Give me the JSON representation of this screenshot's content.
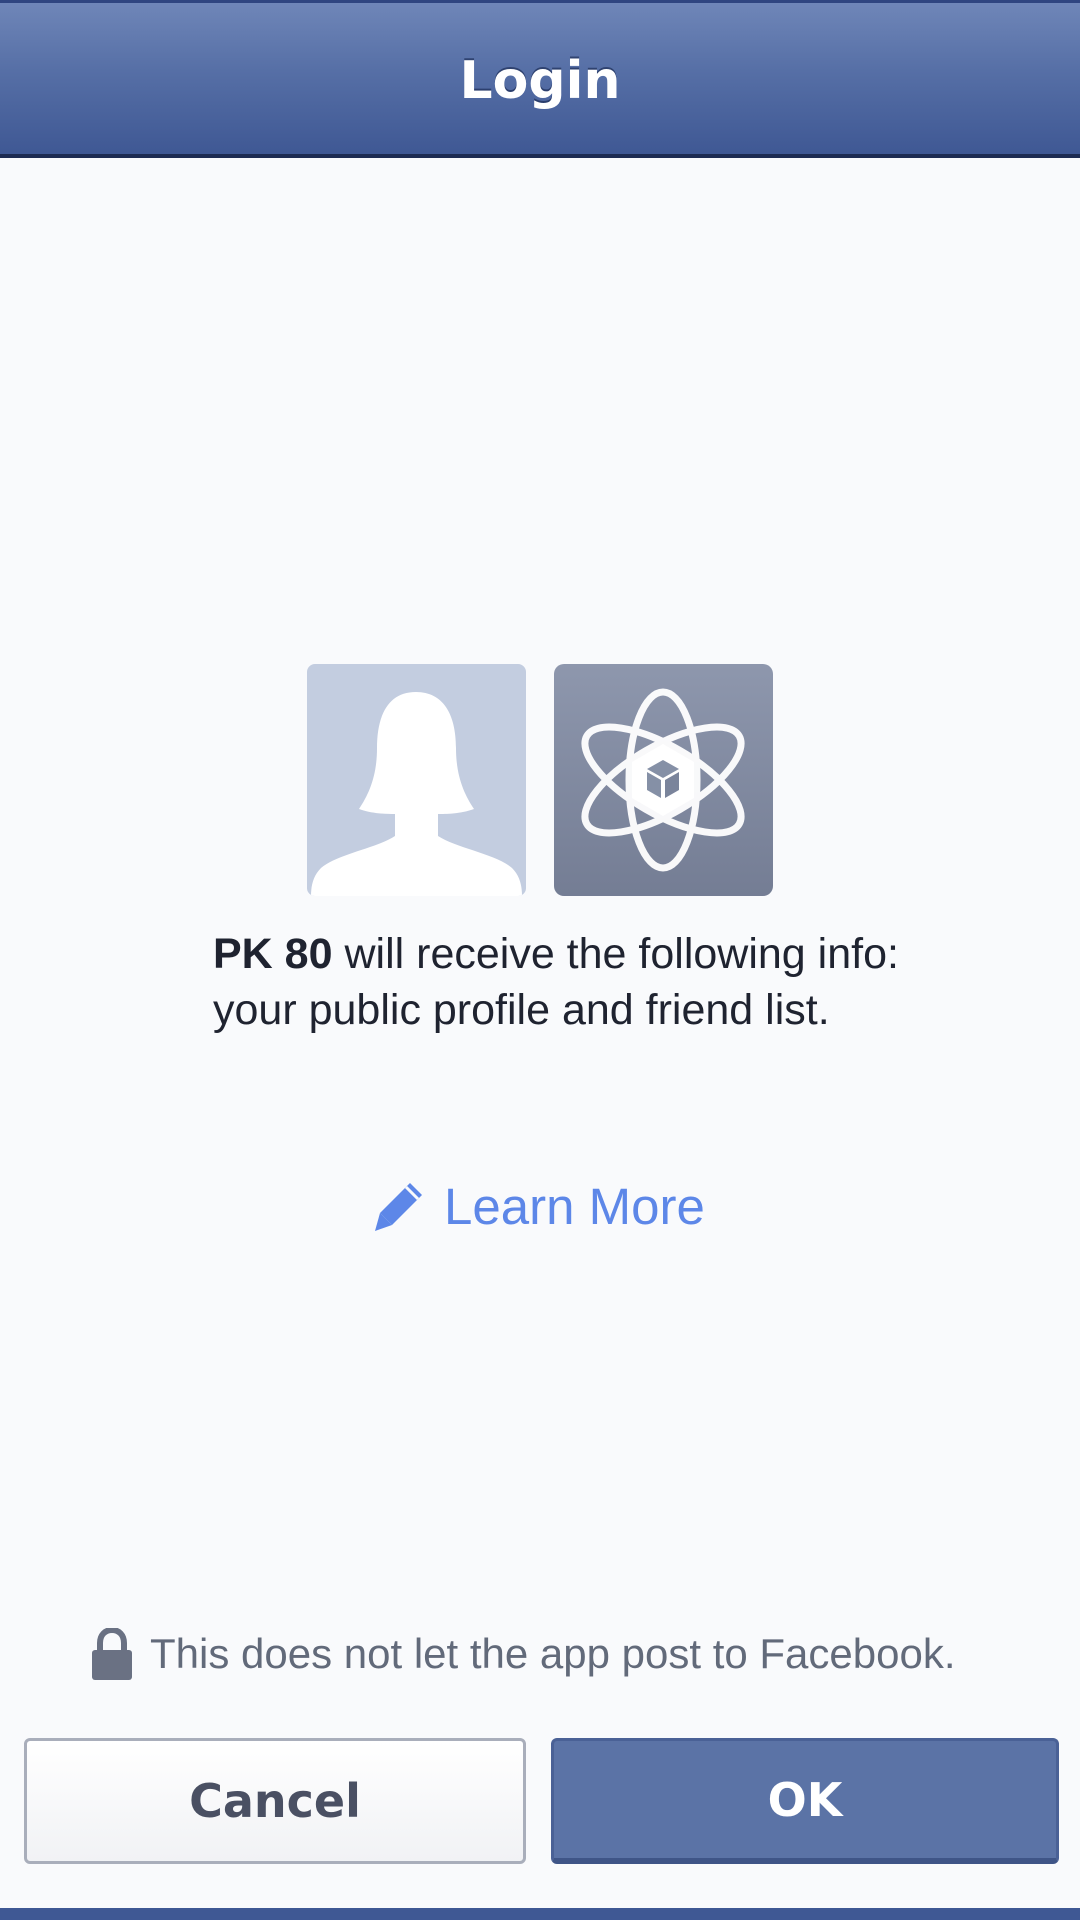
{
  "header": {
    "title": "Login"
  },
  "avatars": {
    "user_icon": "user-silhouette-icon",
    "app_icon": "atom-cube-icon"
  },
  "info": {
    "app_name": "PK 80",
    "line1_rest": " will receive the following info:",
    "line2": "your public profile and friend list."
  },
  "learn_more": {
    "icon": "pencil-icon",
    "label": "Learn More"
  },
  "notice": {
    "icon": "lock-icon",
    "text": "This does not let the app post to Facebook."
  },
  "buttons": {
    "cancel_label": "Cancel",
    "ok_label": "OK"
  },
  "colors": {
    "header_blue": "#566fa6",
    "link_blue": "#5d87e8",
    "ok_button": "#5b73a6",
    "background": "#f9fafc"
  }
}
